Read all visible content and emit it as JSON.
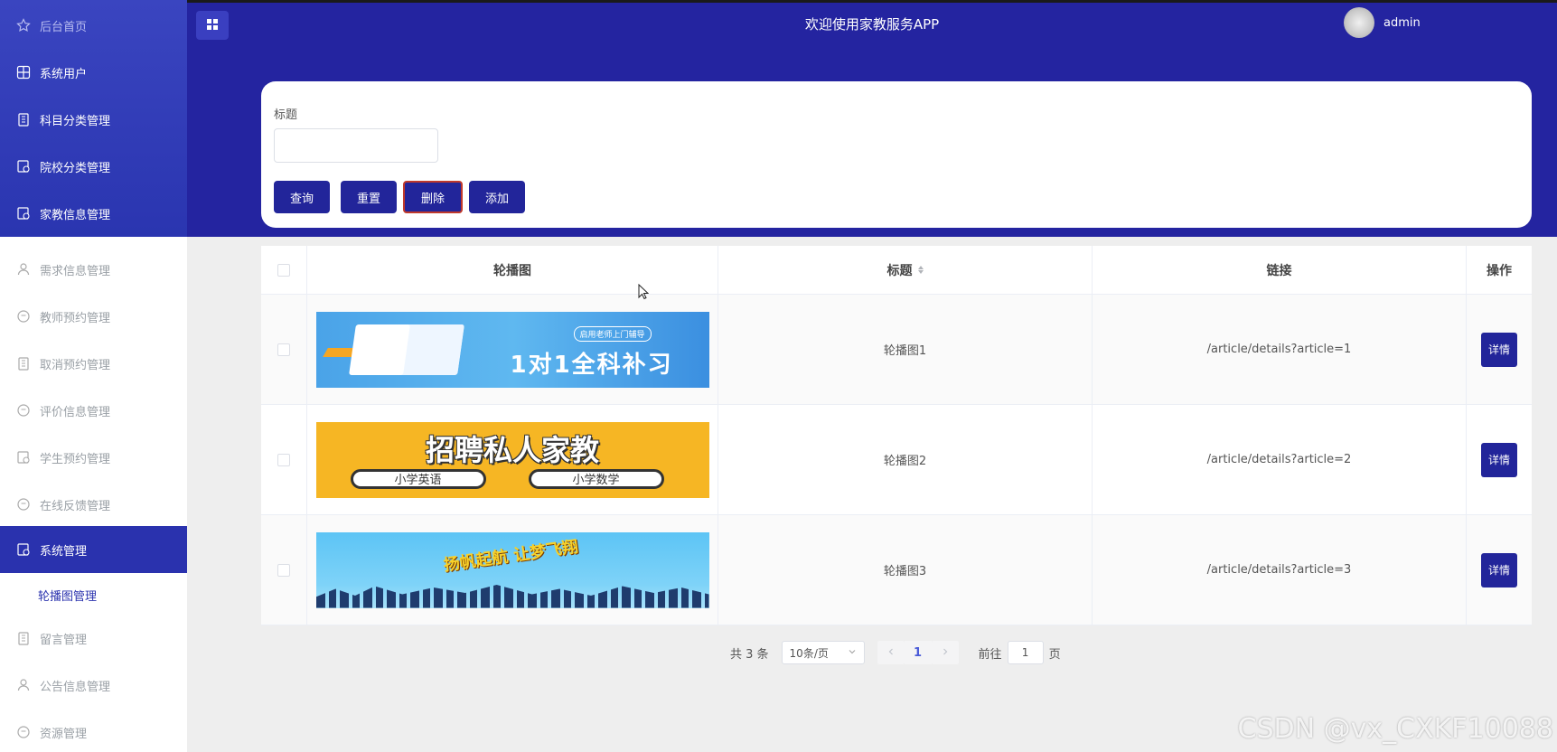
{
  "header": {
    "title": "欢迎使用家教服务APP",
    "user_name": "admin"
  },
  "sidebar": {
    "items": [
      {
        "label": "后台首页",
        "icon": "star-icon"
      },
      {
        "label": "系统用户",
        "icon": "grid-icon"
      },
      {
        "label": "科目分类管理",
        "icon": "clipboard-icon"
      },
      {
        "label": "院校分类管理",
        "icon": "document-icon"
      },
      {
        "label": "家教信息管理",
        "icon": "document-icon"
      },
      {
        "label": "需求信息管理",
        "icon": "user-icon"
      },
      {
        "label": "教师预约管理",
        "icon": "chat-icon"
      },
      {
        "label": "取消预约管理",
        "icon": "clipboard-icon"
      },
      {
        "label": "评价信息管理",
        "icon": "chat-icon"
      },
      {
        "label": "学生预约管理",
        "icon": "document-icon"
      },
      {
        "label": "在线反馈管理",
        "icon": "chat-icon"
      },
      {
        "label": "系统管理",
        "icon": "document-icon"
      },
      {
        "label": "留言管理",
        "icon": "clipboard-icon"
      },
      {
        "label": "公告信息管理",
        "icon": "user-icon"
      },
      {
        "label": "资源管理",
        "icon": "chat-icon"
      }
    ],
    "submenu": {
      "label": "轮播图管理"
    }
  },
  "search": {
    "field_label": "标题",
    "field_value": "",
    "buttons": {
      "query": "查询",
      "reset": "重置",
      "delete": "删除",
      "add": "添加"
    }
  },
  "table": {
    "columns": {
      "image": "轮播图",
      "title": "标题",
      "link": "链接",
      "actions": "操作"
    },
    "rows": [
      {
        "banner_text": "1对1全科补习",
        "banner_tag": "启用老师上门辅导",
        "title": "轮播图1",
        "link": "/article/details?article=1",
        "action": "详情"
      },
      {
        "banner_text": "招聘私人家教",
        "banner_pill_left": "小学英语",
        "banner_pill_right": "小学数学",
        "title": "轮播图2",
        "link": "/article/details?article=2",
        "action": "详情"
      },
      {
        "banner_text": "扬帆起航 让梦飞翔",
        "title": "轮播图3",
        "link": "/article/details?article=3",
        "action": "详情"
      }
    ]
  },
  "pagination": {
    "total": "共 3 条",
    "page_size": "10条/页",
    "current_page": "1",
    "goto_label": "前往",
    "goto_value": "1",
    "page_suffix": "页"
  },
  "watermark": "CSDN @vx_CXKF10088",
  "colors": {
    "primary": "#22259a",
    "header_bg": "#2424a0",
    "sidebar_active": "#2a32ae"
  }
}
